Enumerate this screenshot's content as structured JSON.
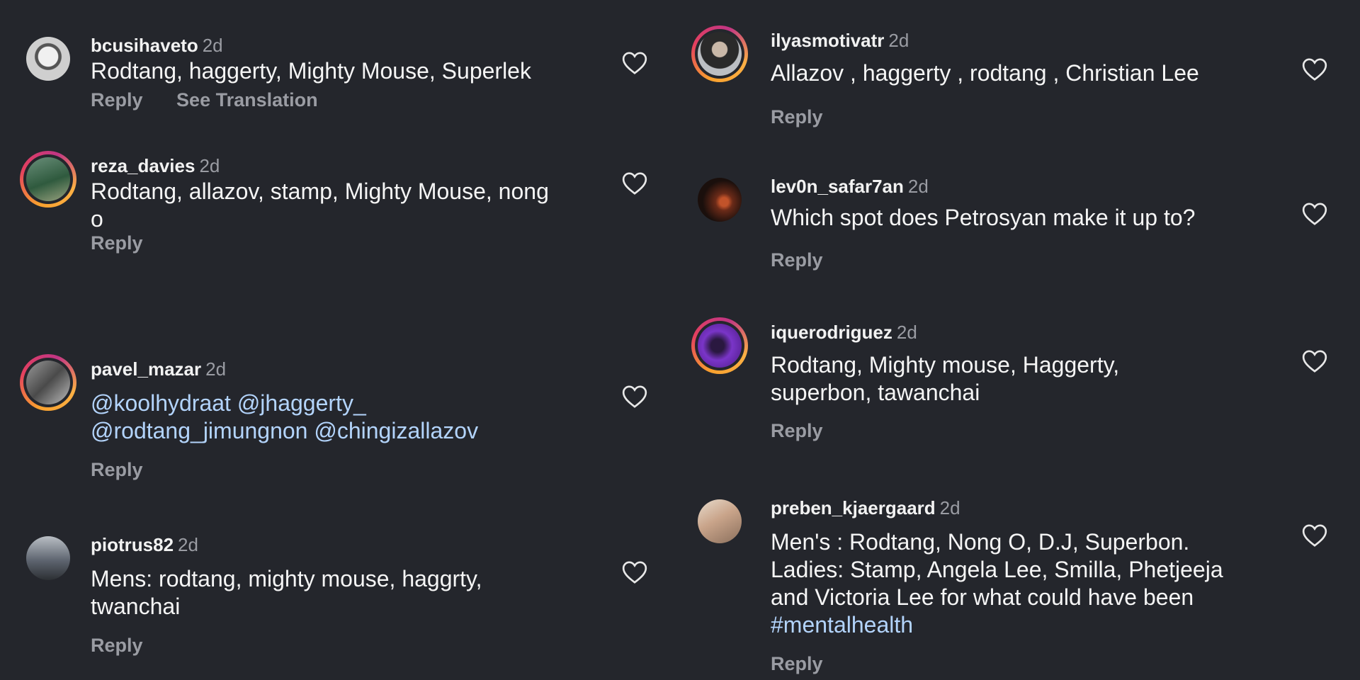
{
  "left": [
    {
      "username": "bcusihaveto",
      "time": "2d",
      "text": "Rodtang, haggerty, Mighty Mouse, Superlek",
      "actions": [
        "Reply",
        "See Translation"
      ],
      "avatar_style": "plain",
      "avatar_color": "#d9d9d9"
    },
    {
      "username": "reza_davies",
      "time": "2d",
      "text": "Rodtang, allazov, stamp, Mighty Mouse, nong o",
      "actions": [
        "Reply"
      ],
      "avatar_style": "ring",
      "avatar_color": "#4e7a5a"
    },
    {
      "username": "pavel_mazar",
      "time": "2d",
      "text": "@koolhydraat @jhaggerty_ @rodtang_jimungnon @chingizallazov",
      "actions": [
        "Reply"
      ],
      "avatar_style": "ring",
      "avatar_color": "#6a6a6a",
      "mention": true
    },
    {
      "username": "piotrus82",
      "time": "2d",
      "text": "Mens: rodtang, mighty mouse, haggrty, twanchai",
      "actions": [
        "Reply"
      ],
      "avatar_style": "plain",
      "avatar_color": "#8a8f96"
    }
  ],
  "right": [
    {
      "username": "ilyasmotivatr",
      "time": "2d",
      "text": "Allazov , haggerty , rodtang , Christian Lee",
      "actions": [
        "Reply"
      ],
      "avatar_style": "ring",
      "avatar_color": "#bfc2c6"
    },
    {
      "username": "lev0n_safar7an",
      "time": "2d",
      "text": "Which spot does Petrosyan make it up to?",
      "actions": [
        "Reply"
      ],
      "avatar_style": "plain",
      "avatar_color": "#3a1a12"
    },
    {
      "username": "iquerodriguez",
      "time": "2d",
      "text": "Rodtang, Mighty mouse, Haggerty, superbon, tawanchai",
      "actions": [
        "Reply"
      ],
      "avatar_style": "ring",
      "avatar_color": "#6b2aa8"
    },
    {
      "username": "preben_kjaergaard",
      "time": "2d",
      "text": "Men's : Rodtang, Nong O, D.J, Superbon. Ladies: Stamp, Angela Lee,  Smilla, Phetjeeja and Victoria Lee for what could have been ",
      "hashtag": "#mentalhealth",
      "actions": [
        "Reply"
      ],
      "avatar_style": "plain",
      "avatar_color": "#c9b6a4"
    }
  ],
  "colors": {
    "background": "#24262c",
    "secondary_text": "#9a9ca3",
    "link": "#b3d4fc"
  },
  "icons": {
    "like": "heart-outline-icon"
  }
}
